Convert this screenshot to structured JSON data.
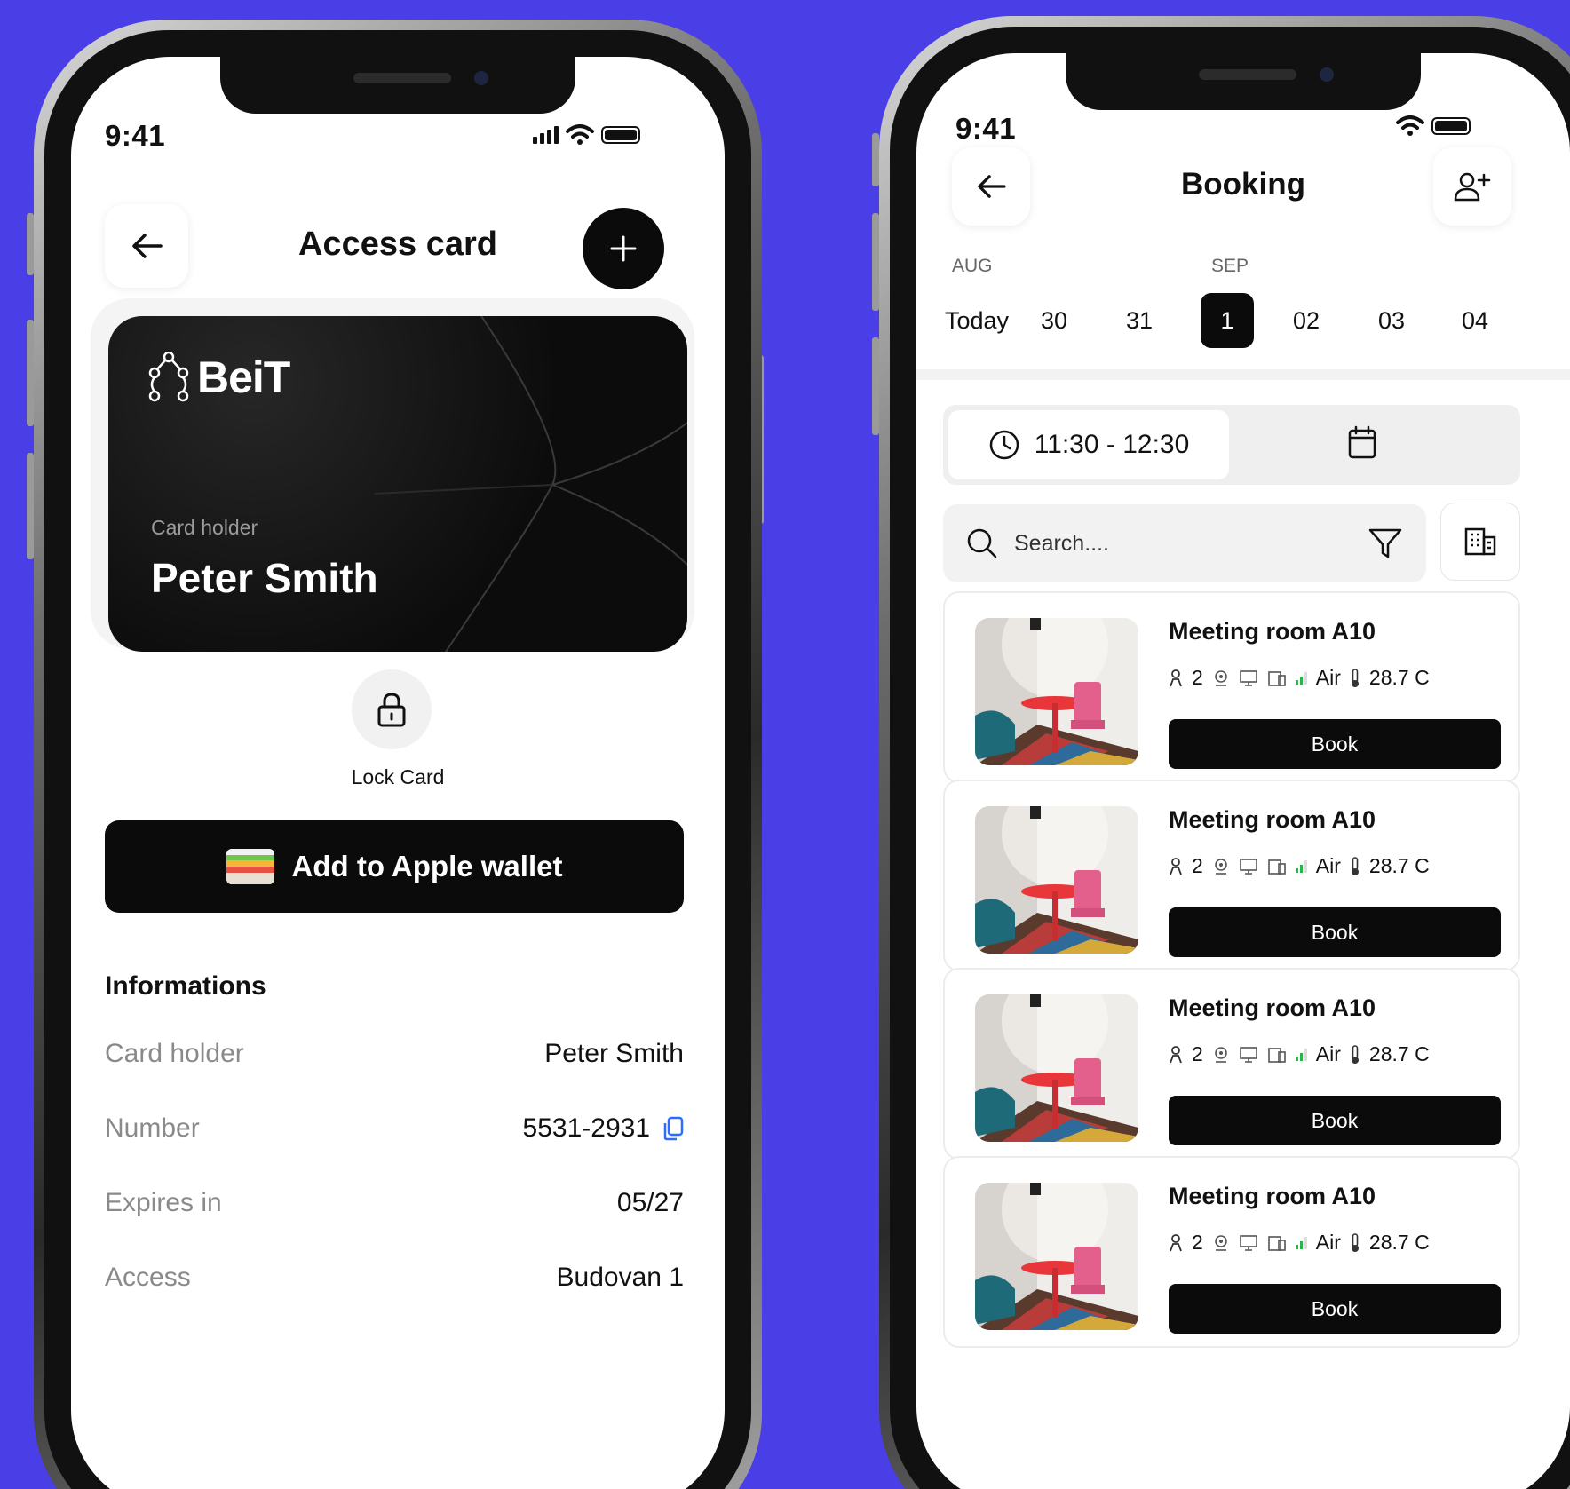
{
  "left_screen": {
    "status_time": "9:41",
    "title": "Access card",
    "card": {
      "brand": "BeiT",
      "holder_label": "Card holder",
      "holder_name": "Peter Smith"
    },
    "lock_label": "Lock Card",
    "wallet_button": "Add to Apple wallet",
    "info_title": "Informations",
    "info_rows": [
      {
        "key": "Card holder",
        "value": "Peter Smith"
      },
      {
        "key": "Number",
        "value": "5531-2931"
      },
      {
        "key": "Expires in",
        "value": "05/27"
      },
      {
        "key": "Access",
        "value": "Budovan 1"
      }
    ],
    "icons": [
      "back-arrow-icon",
      "plus-icon",
      "lock-icon",
      "wallet-icon",
      "copy-icon"
    ]
  },
  "right_screen": {
    "status_time": "9:41",
    "title": "Booking",
    "months": {
      "aug": "AUG",
      "sep": "SEP"
    },
    "dates": [
      "Today",
      "30",
      "31",
      "1",
      "02",
      "03",
      "04"
    ],
    "selected_date": "1",
    "time_range": "11:30 - 12:30",
    "search_placeholder": "Search....",
    "rooms": [
      {
        "name": "Meeting room A10",
        "capacity": "2",
        "air": "Air",
        "temperature": "28.7 C",
        "book": "Book"
      },
      {
        "name": "Meeting room A10",
        "capacity": "2",
        "air": "Air",
        "temperature": "28.7 C",
        "book": "Book"
      },
      {
        "name": "Meeting room A10",
        "capacity": "2",
        "air": "Air",
        "temperature": "28.7 C",
        "book": "Book"
      },
      {
        "name": "Meeting room A10",
        "capacity": "2",
        "air": "Air",
        "temperature": "28.7 C",
        "book": "Book"
      }
    ],
    "icons": [
      "back-arrow-icon",
      "add-user-icon",
      "clock-icon",
      "calendar-icon",
      "search-icon",
      "filter-icon",
      "building-icon",
      "person-icon",
      "webcam-icon",
      "monitor-icon",
      "tablet-icon",
      "signal-icon",
      "thermometer-icon"
    ]
  },
  "colors": {
    "background": "#4a3ee6",
    "accent": "#0b0b0b",
    "copy_icon": "#2f6bff",
    "signal": "#2bb34a"
  }
}
